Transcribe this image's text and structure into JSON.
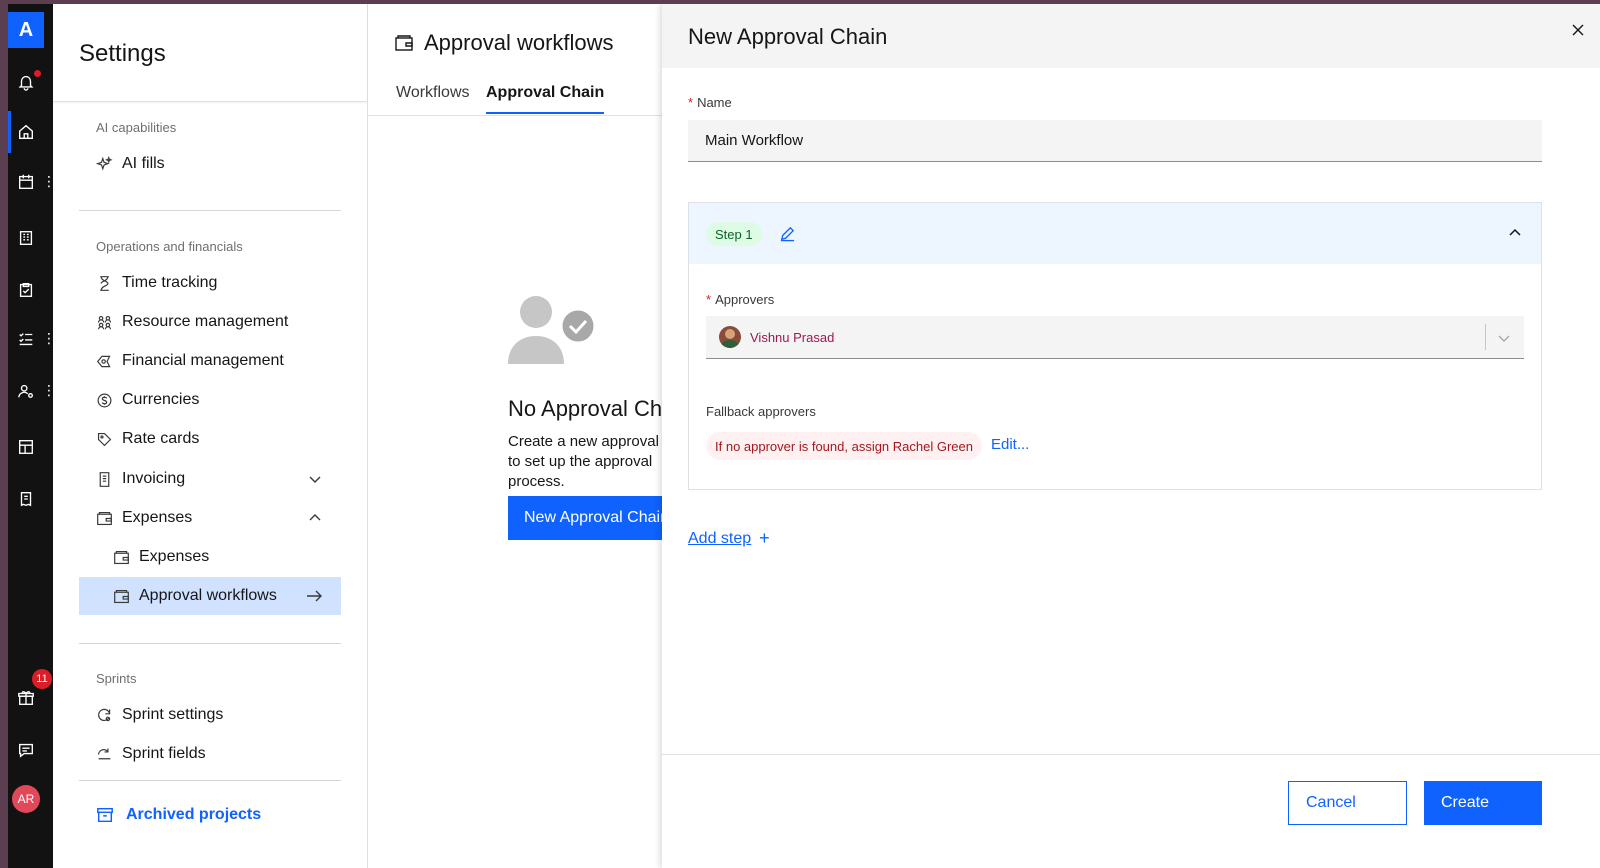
{
  "rail": {
    "logo": "A",
    "notification_count": "11",
    "avatar_initials": "AR"
  },
  "sidebar": {
    "title": "Settings",
    "sections": {
      "ai": {
        "label": "AI capabilities",
        "items": {
          "ai_fills": "AI fills"
        }
      },
      "ops": {
        "label": "Operations and financials",
        "items": {
          "time_tracking": "Time tracking",
          "resource_management": "Resource management",
          "financial_management": "Financial management",
          "currencies": "Currencies",
          "rate_cards": "Rate cards",
          "invoicing": "Invoicing",
          "expenses": "Expenses",
          "expenses_sub": "Expenses",
          "approval_workflows": "Approval workflows"
        }
      },
      "sprints": {
        "label": "Sprints",
        "items": {
          "sprint_settings": "Sprint settings",
          "sprint_fields": "Sprint fields"
        }
      }
    },
    "archived_projects": "Archived projects"
  },
  "main": {
    "title": "Approval workflows",
    "tabs": [
      "Workflows",
      "Approval Chain"
    ],
    "empty_state": {
      "title": "No Approval Chains",
      "description": "Create a new approval chain to set up the approval process.",
      "button": "New Approval Chain"
    }
  },
  "panel": {
    "title": "New Approval Chain",
    "name_label": "Name",
    "name_value": "Main Workflow",
    "step": {
      "tag": "Step 1",
      "approvers_label": "Approvers",
      "approver_name": "Vishnu Prasad",
      "fallback_label": "Fallback approvers",
      "fallback_text": "If no approver is found, assign Rachel Green",
      "edit_link": "Edit..."
    },
    "add_step": "Add step",
    "cancel": "Cancel",
    "create": "Create"
  },
  "colors": {
    "accent": "#0f62fe",
    "active_nav_bg": "#d0e2ff",
    "step_header_bg": "#edf5ff",
    "step_tag_bg": "#defbe6",
    "fallback_tag_bg": "#fff1f1"
  }
}
